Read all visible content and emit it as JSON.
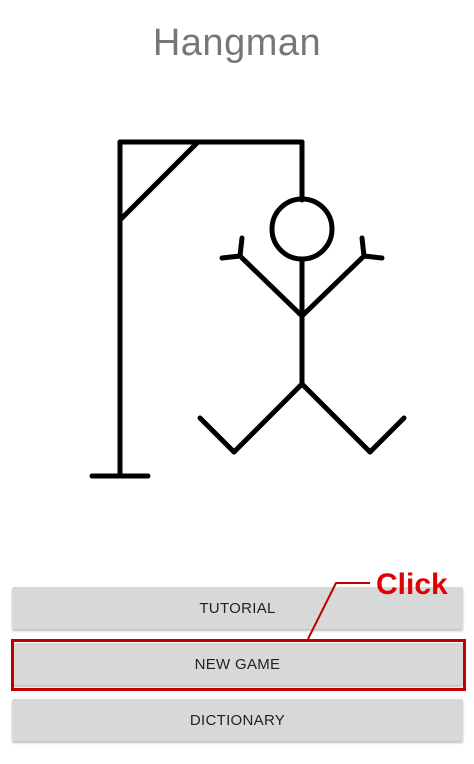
{
  "app": {
    "title": "Hangman"
  },
  "buttons": {
    "tutorial": "TUTORIAL",
    "new_game": "NEW GAME",
    "dictionary": "DICTIONARY"
  },
  "annotation": {
    "label": "Click",
    "color": "#e00000"
  },
  "colors": {
    "button_bg": "#d7d8d8",
    "title": "#777777",
    "highlight": "#c00000"
  }
}
